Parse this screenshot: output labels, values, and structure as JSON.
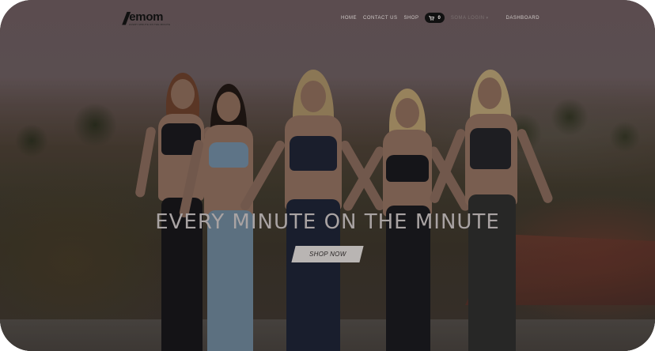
{
  "brand": {
    "mark": "//",
    "name": "emom",
    "tagline": "EVERY MINUTE ON THE MINUTE"
  },
  "nav": {
    "items": [
      "HOME",
      "CONTACT US",
      "SHOP"
    ],
    "cart_count": "0",
    "account_label": "SOMA LOGIN",
    "dashboard_label": "DASHBOARD"
  },
  "hero": {
    "headline": "EVERY MINUTE ON THE MINUTE",
    "cta_label": "SHOP NOW"
  },
  "colors": {
    "cart_bg": "#111111",
    "cta_bg": "#b9b5b3",
    "headline": "#a9a3a3"
  }
}
